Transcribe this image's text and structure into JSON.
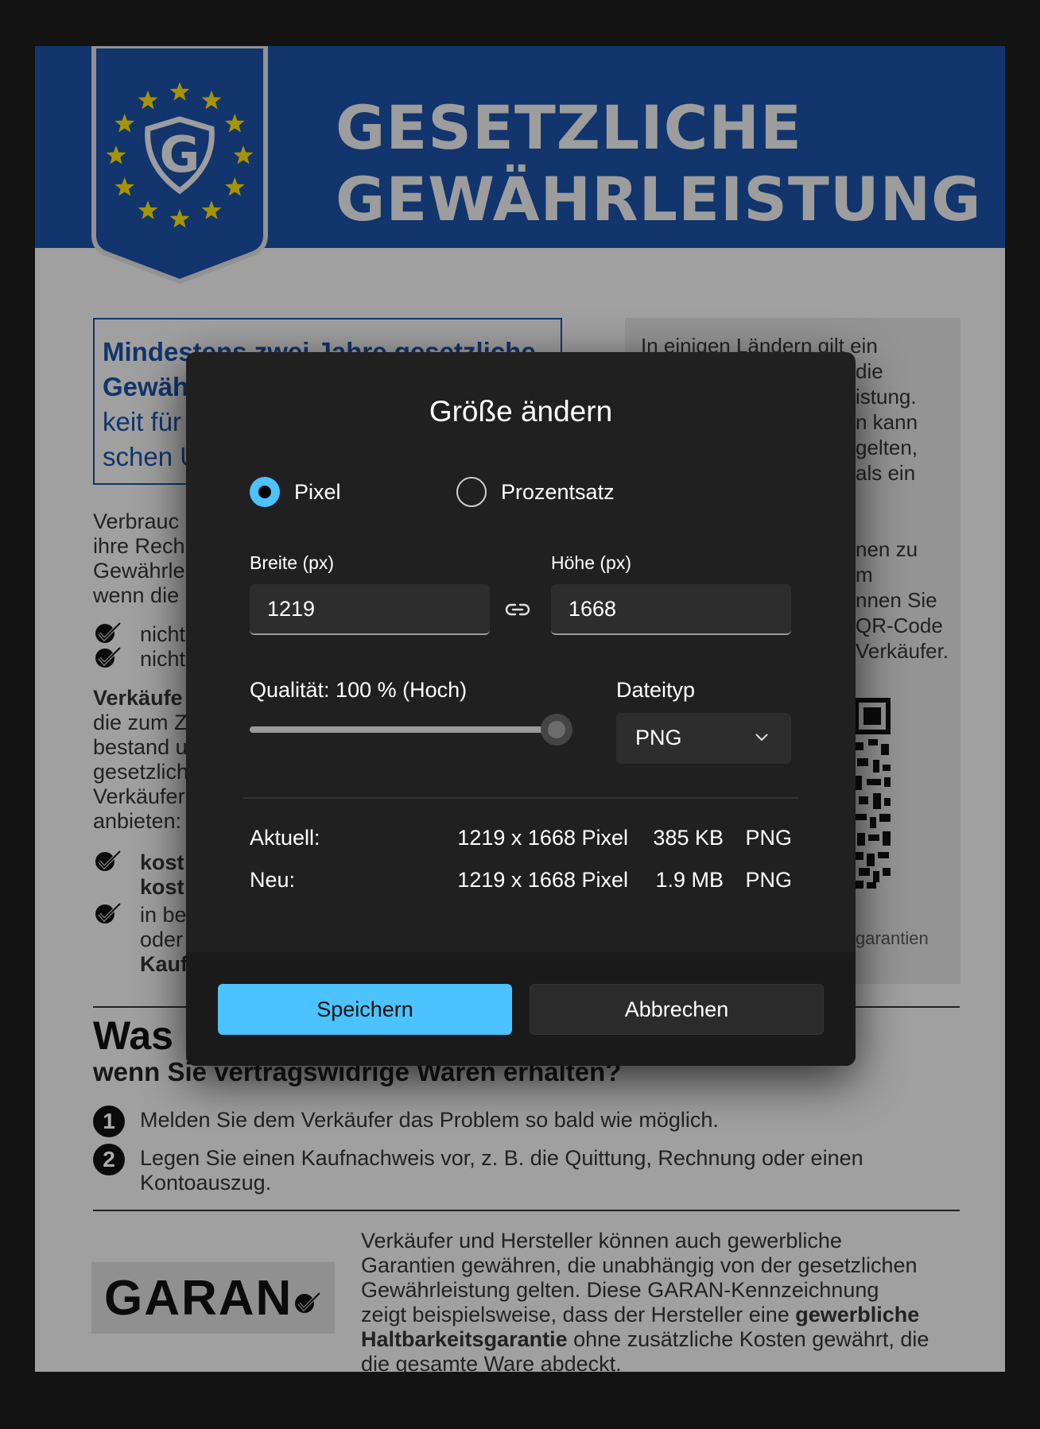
{
  "document": {
    "header_line1": "GESETZLICHE",
    "header_line2": "GEWÄHRLEISTUNG",
    "shield_letter": "G",
    "blue_box_lines": [
      "Mindestens zwei Jahre gesetzliche",
      "Gewähr",
      "keit für",
      "schen U"
    ],
    "grey_box_lines": [
      "In einigen Ländern gilt ein",
      "die",
      "istung.",
      "n kann",
      "gelten,",
      "als ein",
      "nen zu",
      "m",
      "nnen Sie",
      "QR-Code",
      "Verkäufer.",
      "garantien"
    ],
    "left_lines": [
      "Verbrauc",
      "ihre Rech",
      "Gewährle",
      "wenn die"
    ],
    "check1": "nicht",
    "check2": "nicht",
    "verk_lines": [
      "Verkäufe",
      "die zum Z",
      "bestand u",
      "gesetzlich",
      "Verkäufer",
      "anbieten:"
    ],
    "check3_lines": [
      "kost",
      "kost"
    ],
    "check4_lines": [
      "in be",
      "oder",
      "Kauf"
    ],
    "was_heading": "Was",
    "subheading": "wenn Sie vertragswidrige Waren erhalten?",
    "step1_num": "1",
    "step1": "Melden Sie dem Verkäufer das Problem so bald wie möglich.",
    "step2_num": "2",
    "step2_lines": [
      "Legen Sie einen Kaufnachweis vor, z. B. die Quittung, Rechnung oder einen",
      "Kontoauszug."
    ],
    "garan_logo": "GARAN",
    "bottom_lines": [
      [
        "Verkäufer und Hersteller können auch gewerbliche",
        "",
        ""
      ],
      [
        "Garantien gewähren, die unabhängig von der gesetzlichen",
        "",
        ""
      ],
      [
        "Gewährleistung gelten. Diese GARAN-Kennzeichnung",
        "",
        ""
      ],
      [
        "zeigt beispielsweise, dass der Hersteller eine ",
        "gewerbliche",
        ""
      ],
      [
        "",
        "Haltbarkeitsgarantie",
        " ohne zusätzliche Kosten gewährt, die"
      ],
      [
        "die gesamte Ware abdeckt.",
        "",
        ""
      ]
    ]
  },
  "dialog": {
    "title": "Größe ändern",
    "radio_pixel": "Pixel",
    "radio_percent": "Prozentsatz",
    "selected_mode": "pixel",
    "width_label": "Breite  (px)",
    "height_label": "Höhe  (px)",
    "width_value": "1219",
    "height_value": "1668",
    "quality_label": "Qualität: 100 % (Hoch)",
    "quality_value": 100,
    "filetype_label": "Dateityp",
    "filetype_value": "PNG",
    "current_label": "Aktuell:",
    "current_dims": "1219 x 1668 Pixel",
    "current_size": "385 KB",
    "current_type": "PNG",
    "new_label": "Neu:",
    "new_dims": "1219 x 1668 Pixel",
    "new_size": "1.9 MB",
    "new_type": "PNG",
    "save_label": "Speichern",
    "cancel_label": "Abbrechen",
    "accent_color": "#4cc2ff"
  }
}
